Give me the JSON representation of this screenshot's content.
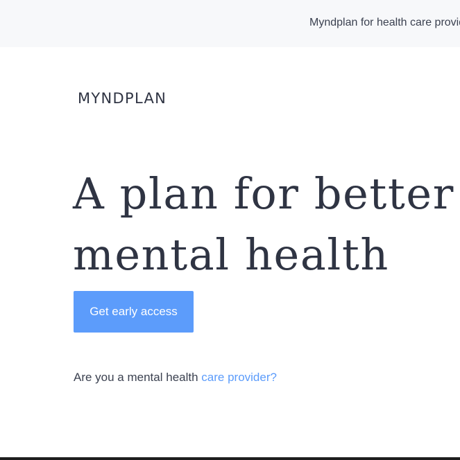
{
  "banner": {
    "provider_link_text": "Myndplan for health care providers"
  },
  "logo": {
    "text": "MYNDPLAN"
  },
  "hero": {
    "title_line1": "A plan for better",
    "title_line2": "mental health",
    "cta_label": "Get early access"
  },
  "provider_prompt": {
    "text": "Are you a mental health ",
    "link_text": "care provider?"
  },
  "colors": {
    "accent": "#5c9cfb",
    "text": "#2f3443",
    "banner_bg": "#f7f8fa"
  }
}
